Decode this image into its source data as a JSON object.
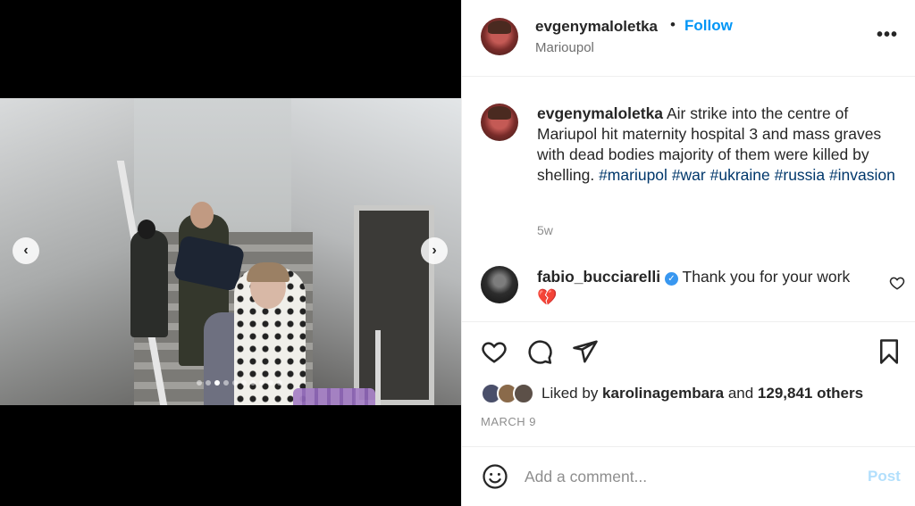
{
  "post": {
    "username": "evgenymaloletka",
    "separator": "•",
    "follow_label": "Follow",
    "location": "Marioupol",
    "more_label": "•••",
    "caption_text": " Air strike into the centre of Mariupol hit maternity hospital 3 and mass graves with dead bodies majority of them were killed by shelling. ",
    "hashtags": [
      "#mariupol",
      "#war",
      "#ukraine",
      "#russia",
      "#invasion"
    ],
    "age": "5w"
  },
  "comment": {
    "username": "fabio_bucciarelli",
    "text": " Thank you for your work",
    "emoji": "💔"
  },
  "likes": {
    "prefix": "Liked by ",
    "user": "karolinagembara",
    "middle": " and ",
    "count": "129,841 others"
  },
  "date": "MARCH 9",
  "add_comment": {
    "placeholder": "Add a comment...",
    "post_label": "Post"
  },
  "carousel": {
    "prev_glyph": "‹",
    "next_glyph": "›",
    "slide_count": 10,
    "active_slide": 3
  },
  "colors": {
    "accent": "#0095f6",
    "hashtag": "#00376b",
    "post_disabled": "#b2dffc",
    "verified": "#3897f0"
  }
}
